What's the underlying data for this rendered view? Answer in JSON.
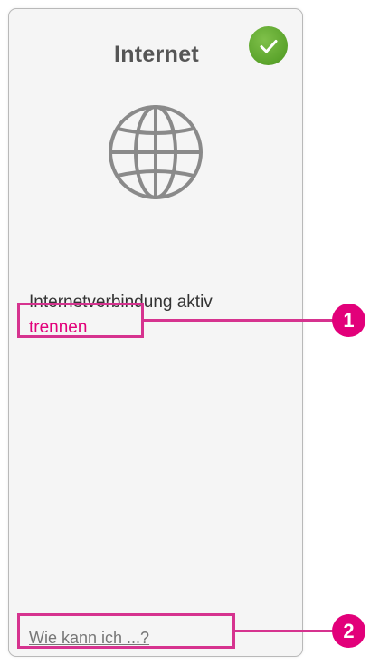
{
  "card": {
    "title": "Internet",
    "status_icon": "check-icon",
    "main_icon": "globe-icon",
    "status_text": "Internetverbindung aktiv",
    "disconnect_label": "trennen",
    "help_label": "Wie kann ich ...?"
  },
  "callouts": [
    {
      "number": "1"
    },
    {
      "number": "2"
    }
  ],
  "colors": {
    "accent": "#e2007a",
    "highlight": "#d6338f",
    "success": "#5aa32b",
    "title": "#555555",
    "text": "#333333",
    "link_muted": "#777777"
  }
}
